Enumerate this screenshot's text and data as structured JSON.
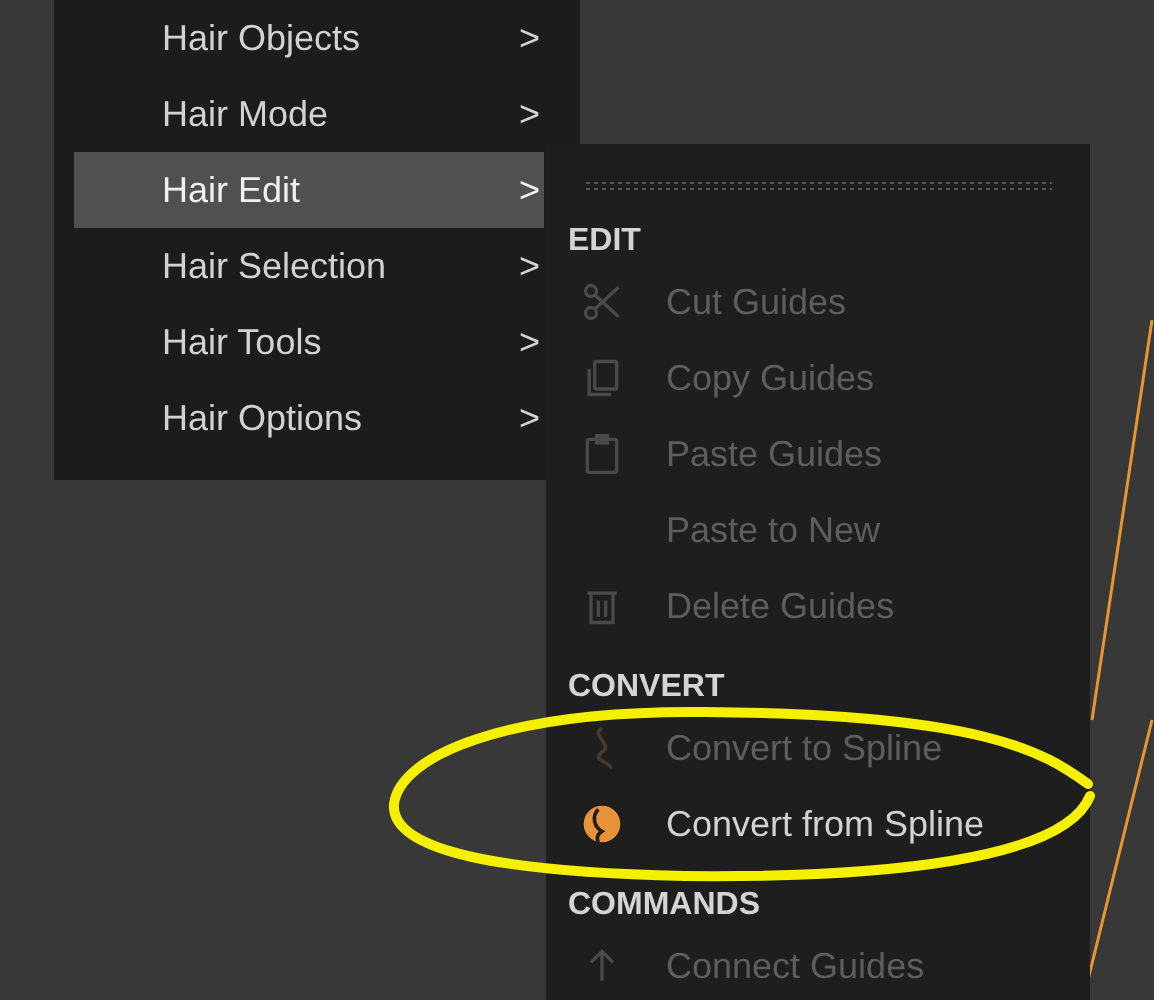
{
  "menu": {
    "items": [
      {
        "label": "Hair Objects",
        "selected": false,
        "submenu_arrow": ">"
      },
      {
        "label": "Hair Mode",
        "selected": false,
        "submenu_arrow": ">"
      },
      {
        "label": "Hair Edit",
        "selected": true,
        "submenu_arrow": ">"
      },
      {
        "label": "Hair Selection",
        "selected": false,
        "submenu_arrow": ">"
      },
      {
        "label": "Hair Tools",
        "selected": false,
        "submenu_arrow": ">"
      },
      {
        "label": "Hair Options",
        "selected": false,
        "submenu_arrow": ">"
      }
    ]
  },
  "submenu": {
    "sections": [
      {
        "title": "EDIT",
        "items": [
          {
            "label": "Cut Guides",
            "kind": "scissors",
            "disabled": true
          },
          {
            "label": "Copy Guides",
            "kind": "copy",
            "disabled": true
          },
          {
            "label": "Paste Guides",
            "kind": "clipboard",
            "disabled": true
          },
          {
            "label": "Paste to New",
            "kind": "none",
            "disabled": true
          },
          {
            "label": "Delete Guides",
            "kind": "trash",
            "disabled": true
          }
        ]
      },
      {
        "title": "CONVERT",
        "items": [
          {
            "label": "Convert to Spline",
            "kind": "spline",
            "disabled": true
          },
          {
            "label": "Convert from Spline",
            "kind": "hair",
            "disabled": false
          }
        ]
      },
      {
        "title": "COMMANDS",
        "items": [
          {
            "label": "Connect Guides",
            "kind": "arrow",
            "disabled": true
          }
        ]
      }
    ]
  }
}
